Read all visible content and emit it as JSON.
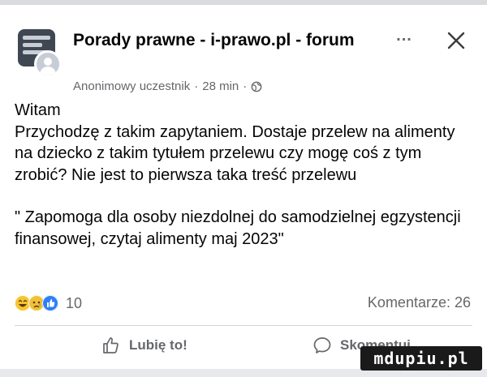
{
  "post": {
    "group_name": "Porady prawne - i-prawo.pl - forum",
    "author": "Anonimowy uczestnik",
    "separator": "·",
    "time": "28 min",
    "privacy_icon": "globe-icon",
    "more_label": "...",
    "close_icon": "close-icon"
  },
  "body": {
    "greeting": "Witam",
    "paragraph1": "Przychodzę z takim zapytaniem. Dostaje przelew na alimenty na dziecko z takim tytułem przelewu czy mogę coś z tym zrobić? Nie jest to pierwsza taka treść przelewu",
    "paragraph2": "\" Zapomoga  dla osoby niezdolnej do samodzielnej egzystencji finansowej, czytaj alimenty maj 2023\""
  },
  "stats": {
    "reaction_icons": [
      "haha-icon",
      "sad-icon",
      "like-icon"
    ],
    "reaction_count": "10",
    "comments_label": "Komentarze: 26"
  },
  "actions": {
    "like_label": "Lubię to!",
    "comment_label": "Skomentuj"
  },
  "watermark": {
    "text": "mdupiu.pl"
  },
  "colors": {
    "like_blue": "#2d7ff9",
    "reaction_yellow": "#f7c531",
    "muted_text": "#65676b"
  }
}
